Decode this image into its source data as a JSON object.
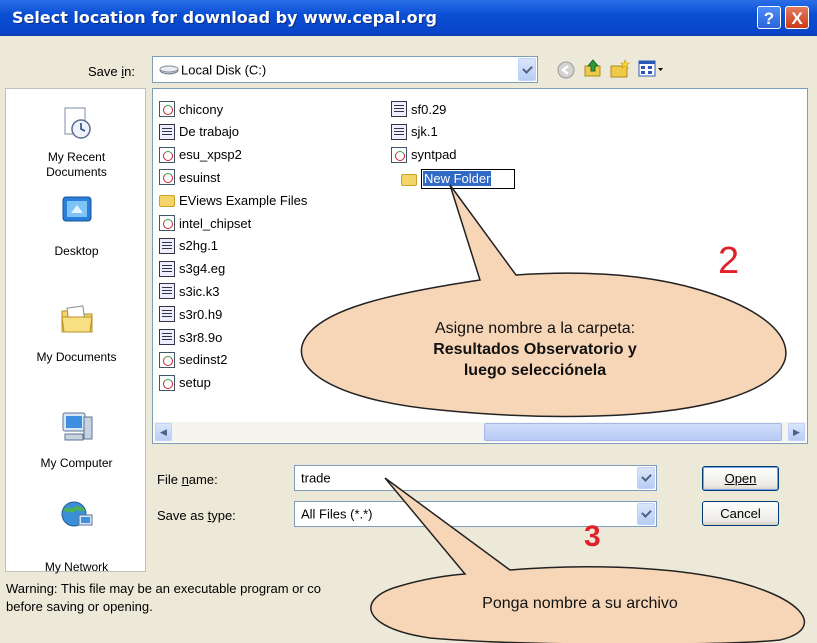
{
  "window": {
    "title": "Select location for download by www.cepal.org",
    "help_glyph": "?",
    "close_glyph": "X"
  },
  "toolbar": {
    "save_in_label": "Save in:",
    "save_in_value": "Local Disk (C:)"
  },
  "places": [
    {
      "label": "My Recent Documents",
      "icon": "recent-documents-icon"
    },
    {
      "label": "Desktop",
      "icon": "desktop-icon"
    },
    {
      "label": "My Documents",
      "icon": "my-documents-icon"
    },
    {
      "label": "My Computer",
      "icon": "my-computer-icon"
    },
    {
      "label": "My Network",
      "icon": "my-network-icon"
    }
  ],
  "files": {
    "column1": [
      {
        "name": "chicony",
        "type": "exe"
      },
      {
        "name": "De trabajo",
        "type": "doc"
      },
      {
        "name": "esu_xpsp2",
        "type": "exe"
      },
      {
        "name": "esuinst",
        "type": "exe"
      },
      {
        "name": "EViews Example Files",
        "type": "folder"
      },
      {
        "name": "intel_chipset",
        "type": "exe"
      },
      {
        "name": "s2hg.1",
        "type": "doc"
      },
      {
        "name": "s3g4.eg",
        "type": "doc"
      },
      {
        "name": "s3ic.k3",
        "type": "doc"
      },
      {
        "name": "s3r0.h9",
        "type": "doc"
      },
      {
        "name": "s3r8.9o",
        "type": "doc"
      },
      {
        "name": "sedinst2",
        "type": "exe"
      },
      {
        "name": "setup",
        "type": "exe"
      }
    ],
    "column2": [
      {
        "name": "sf0.29",
        "type": "doc"
      },
      {
        "name": "sjk.1",
        "type": "doc"
      },
      {
        "name": "syntpad",
        "type": "exe"
      }
    ],
    "new_folder": "New Folder"
  },
  "form": {
    "file_name_label": "File name:",
    "file_name_value": "trade",
    "save_type_label": "Save as type:",
    "save_type_value": "All Files (*.*)"
  },
  "buttons": {
    "open": "Open",
    "cancel": "Cancel"
  },
  "warning": {
    "line1": "Warning: This file may be an executable program or co",
    "line2": "before saving or opening."
  },
  "annotations": {
    "bubble1_line1": "Asigne nombre a la carpeta:",
    "bubble1_line2": "Resultados Observatorio y",
    "bubble1_line3": "luego selecciónela",
    "step2": "2",
    "step3": "3",
    "bubble2_text": "Ponga nombre a su archivo",
    "accent_color": "#e0202b",
    "bubble_fill": "#f7d6b8"
  }
}
